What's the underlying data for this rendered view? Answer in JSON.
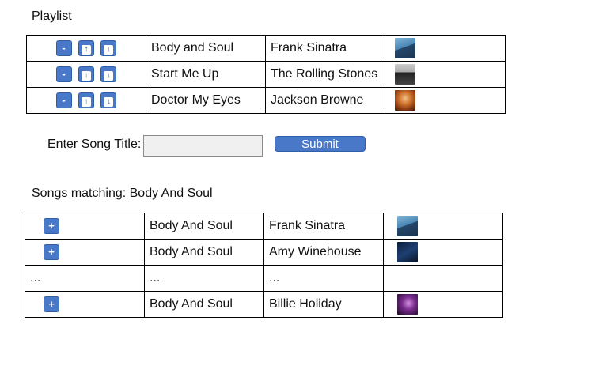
{
  "playlist": {
    "title": "Playlist",
    "controls": {
      "remove": "-",
      "up": "↑",
      "down": "↓"
    },
    "rows": [
      {
        "title": "Body and Soul",
        "artist": "Frank Sinatra",
        "art": "sinatra"
      },
      {
        "title": "Start Me Up",
        "artist": "The Rolling Stones",
        "art": "stones"
      },
      {
        "title": "Doctor My Eyes",
        "artist": "Jackson Browne",
        "art": "browne"
      }
    ]
  },
  "search": {
    "label": "Enter Song Title:",
    "value": "",
    "placeholder": "",
    "submit_label": "Submit"
  },
  "results": {
    "title": "Songs matching: Body And Soul",
    "add_label": "+",
    "ellipsis": "...",
    "rows": [
      {
        "title": "Body And Soul",
        "artist": "Frank Sinatra",
        "art": "sinatra"
      },
      {
        "title": "Body And Soul",
        "artist": "Amy Winehouse",
        "art": "wine"
      },
      {
        "title": "Body And Soul",
        "artist": "Billie Holiday",
        "art": "holiday"
      }
    ]
  }
}
